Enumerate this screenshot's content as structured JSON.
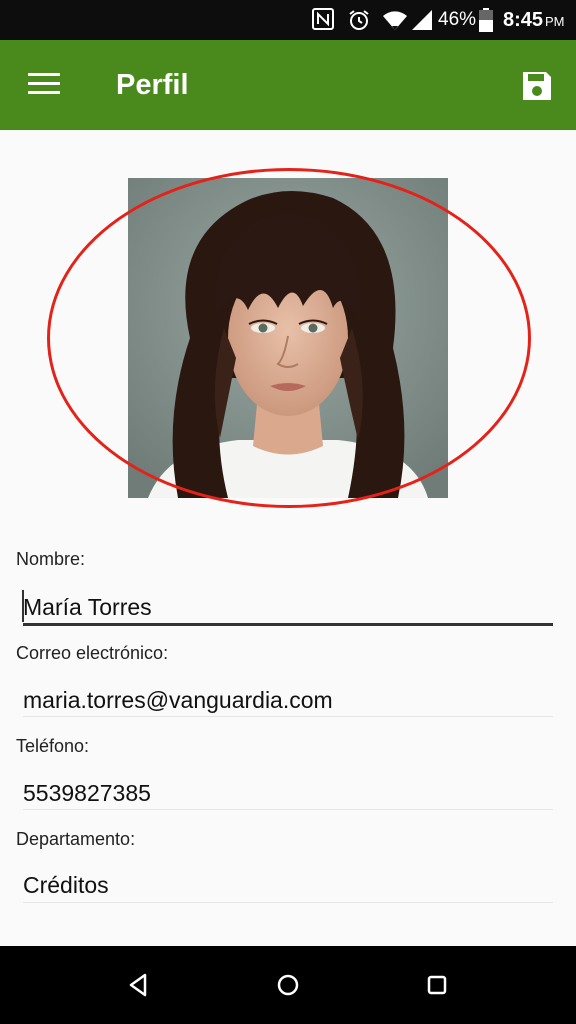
{
  "status_bar": {
    "nfc_icon": "nfc-icon",
    "alarm_icon": "alarm-icon",
    "wifi_icon": "wifi-icon",
    "signal_icon": "signal-icon",
    "battery_icon": "battery-icon",
    "battery": "46%",
    "time": "8:45",
    "ampm": "PM"
  },
  "app_bar": {
    "title": "Perfil",
    "menu_icon": "menu-icon",
    "save_icon": "save-icon",
    "color": "#4a8a1c"
  },
  "profile": {
    "photo_icon": "profile-photo",
    "highlight_color": "#e3231a"
  },
  "form": {
    "name_label": "Nombre:",
    "name_value": "María Torres",
    "email_label": "Correo electrónico:",
    "email_value": "maria.torres@vanguardia.com",
    "phone_label": "Teléfono:",
    "phone_value": "5539827385",
    "department_label": "Departamento:",
    "department_value": "Créditos"
  },
  "nav_bar": {
    "back_icon": "back-icon",
    "home_icon": "home-icon",
    "recents_icon": "recents-icon"
  }
}
